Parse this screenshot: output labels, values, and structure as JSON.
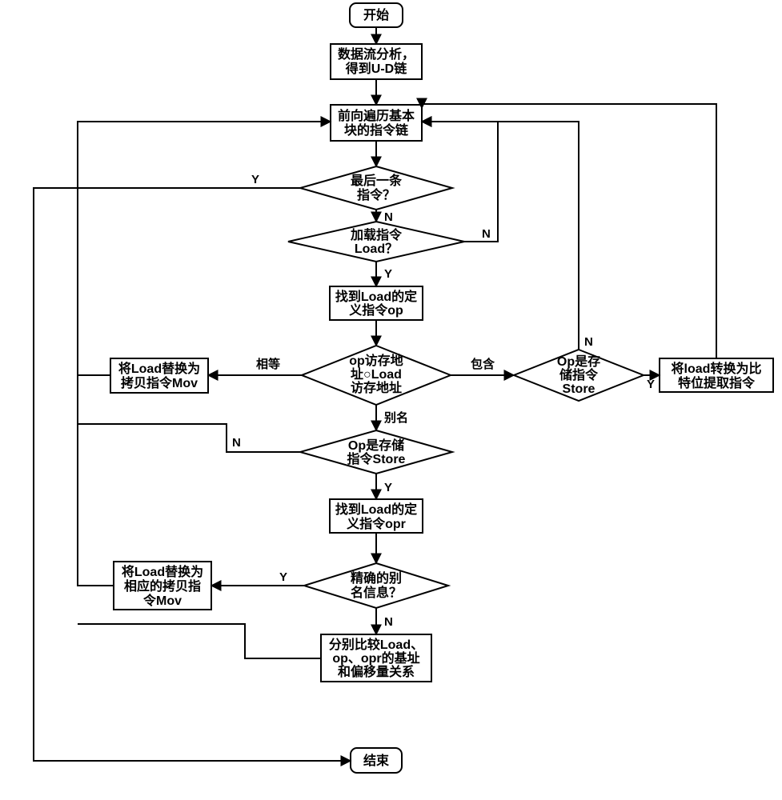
{
  "nodes": {
    "start": [
      "开始"
    ],
    "analyze": [
      "数据流分析，",
      "得到U-D链"
    ],
    "traverse": [
      "前向遍历基本",
      "块的指令链"
    ],
    "last": [
      "最后一条",
      "指令？"
    ],
    "load": [
      "加载指令",
      "Load？"
    ],
    "findop": [
      "找到Load的定",
      "义指令op"
    ],
    "addr": [
      "op访存地",
      "址○Load",
      "访存地址"
    ],
    "mov1": [
      "将Load替换为",
      "拷贝指令Mov"
    ],
    "store2": [
      "Op是存",
      "储指令",
      "Store"
    ],
    "bitext": [
      "将load转换为比",
      "特位提取指令"
    ],
    "store1": [
      "Op是存储",
      "指令Store"
    ],
    "findopr": [
      "找到Load的定",
      "义指令opr"
    ],
    "alias": [
      "精确的别",
      "名信息？"
    ],
    "mov2": [
      "将Load替换为",
      "相应的拷贝指",
      "令Mov"
    ],
    "compare": [
      "分别比较Load、",
      "op、opr的基址",
      "和偏移量关系"
    ],
    "end": [
      "结束"
    ]
  },
  "edges": {
    "lastY": "Y",
    "lastN": "N",
    "loadY": "Y",
    "loadN": "N",
    "addrEq": "相等",
    "addrAlias": "别名",
    "addrContain": "包含",
    "store1Y": "Y",
    "store1N": "N",
    "aliasY": "Y",
    "aliasN": "N",
    "store2Y": "Y",
    "store2N": "N"
  }
}
